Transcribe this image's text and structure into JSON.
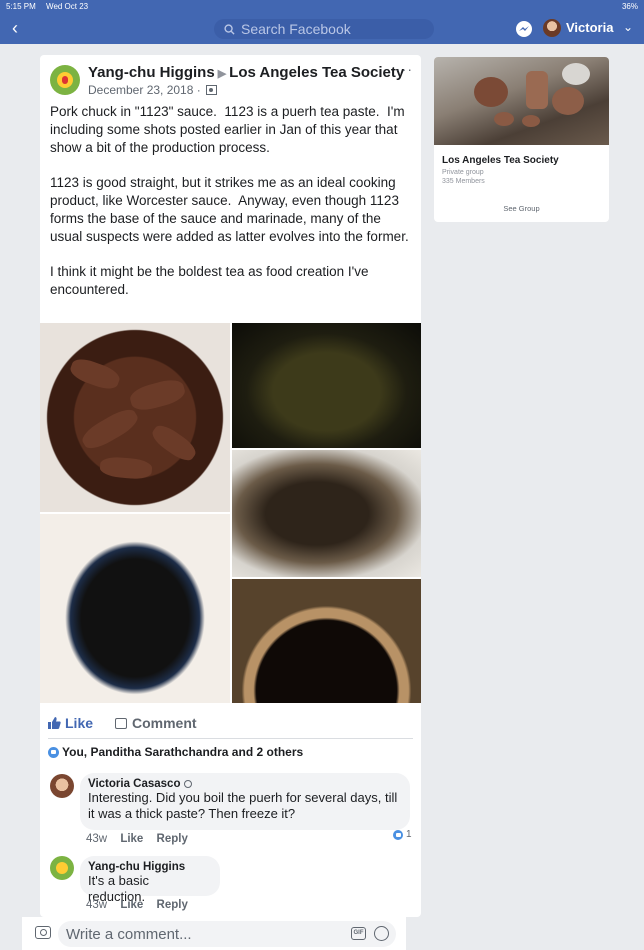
{
  "status": {
    "time": "5:15 PM",
    "date": "Wed Oct 23",
    "battery": "36%"
  },
  "nav": {
    "search_placeholder": "Search Facebook",
    "user_name": "Victoria"
  },
  "post": {
    "author": "Yang-chu Higgins",
    "group": "Los Angeles Tea Society",
    "date": "December 23, 2018 ·",
    "more": "···",
    "text": "Pork chuck in \"1123\" sauce.  1123 is a puerh tea paste.  I'm  including some shots posted earlier in Jan of this year that show a bit of the production process.\n\n1123 is good straight, but it strikes me as an ideal cooking product, like Worcester sauce.  Anyway, even though 1123 forms the base of the sauce and marinade, many of the usual suspects were added as latter evolves into the former.\n\nI think it might be the boldest tea as food creation I've encountered.",
    "like_label": "Like",
    "comment_label": "Comment",
    "reactions": "You, Panditha Sarathchandra and 2 others"
  },
  "comments": [
    {
      "author": "Victoria Casasco",
      "text": "Interesting. Did you boil the puerh for several days, till it was a thick paste? Then freeze it?",
      "time": "43w",
      "like": "Like",
      "reply": "Reply",
      "likes": "1"
    },
    {
      "author": "Yang-chu Higgins",
      "text": "It's a basic reduction.",
      "time": "43w",
      "like": "Like",
      "reply": "Reply"
    }
  ],
  "composer": {
    "placeholder": "Write a comment...",
    "gif": "GIF"
  },
  "group_card": {
    "name": "Los Angeles Tea Society",
    "privacy": "Private group",
    "members": "335 Members",
    "button": "See Group"
  }
}
